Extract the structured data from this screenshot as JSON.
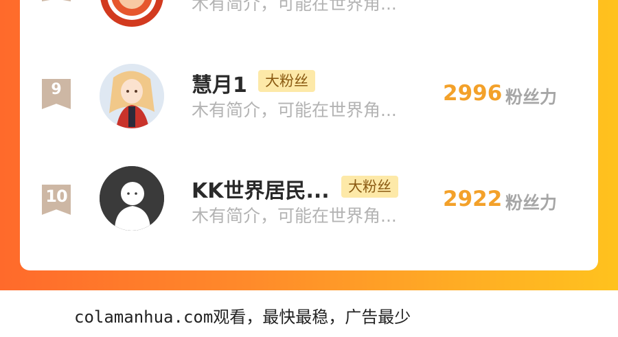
{
  "top_partial": {
    "intro": "木有简介，可能在世界角..."
  },
  "rows": [
    {
      "rank": "9",
      "name": "慧月1",
      "badge": "大粉丝",
      "intro": "木有简介，可能在世界角...",
      "score": "2996",
      "score_unit": "粉丝力"
    },
    {
      "rank": "10",
      "name": "KK世界居民...",
      "badge": "大粉丝",
      "intro": "木有简介，可能在世界角...",
      "score": "2922",
      "score_unit": "粉丝力"
    }
  ],
  "footer": {
    "text": "colamanhua.com观看，最快最稳，广告最少"
  },
  "colors": {
    "accent_orange": "#ff8a2a",
    "score": "#f3a12a",
    "badge_bg": "#fde9a8",
    "rank_flag": "#cdb7a4"
  }
}
